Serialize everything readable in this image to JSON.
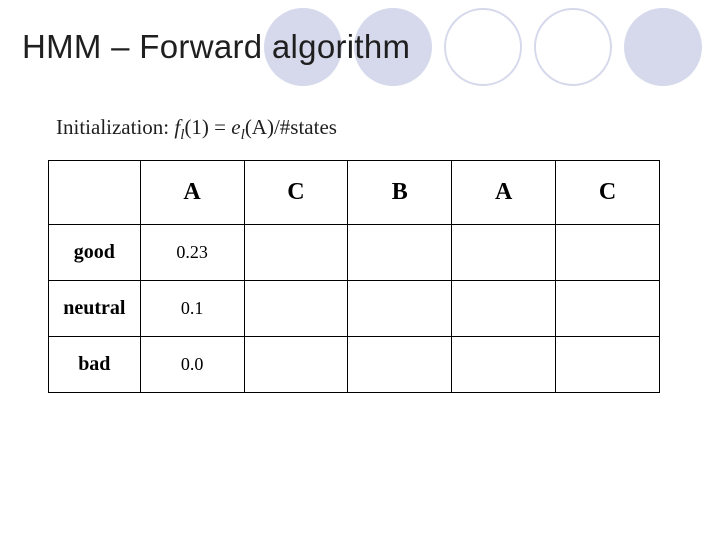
{
  "title": "HMM – Forward algorithm",
  "formula": {
    "prefix": "Initialization:  ",
    "lhs_func": "f",
    "lhs_sub": "l",
    "lhs_arg": "(1) = ",
    "rhs_func": "e",
    "rhs_sub": "l",
    "rhs_arg": "(A)/#states"
  },
  "table": {
    "columns": [
      "A",
      "C",
      "B",
      "A",
      "C"
    ],
    "rows": [
      {
        "label": "good",
        "values": [
          "0.23",
          "",
          "",
          "",
          ""
        ]
      },
      {
        "label": "neutral",
        "values": [
          "0.1",
          "",
          "",
          "",
          ""
        ]
      },
      {
        "label": "bad",
        "values": [
          "0.0",
          "",
          "",
          "",
          ""
        ]
      }
    ]
  }
}
